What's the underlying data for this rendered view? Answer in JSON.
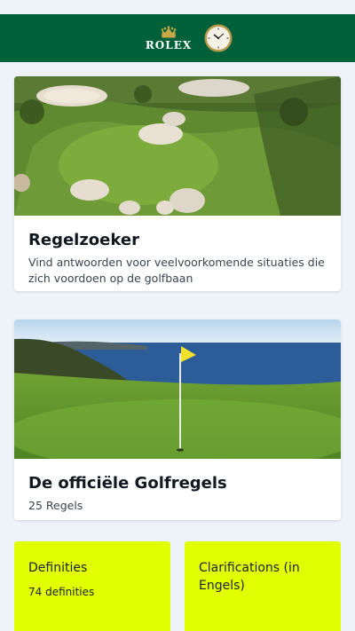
{
  "header": {
    "brand_word": "ROLEX",
    "logo_icon": "rolex-crown-icon",
    "clock_icon": "rolex-clock-icon",
    "bg_color": "#006039"
  },
  "cards": {
    "rules_finder": {
      "title": "Regelzoeker",
      "subtitle": "Vind antwoorden voor veelvoorkomende situaties die zich voordoen op de golfbaan"
    },
    "official_rules": {
      "title": "De officiële Golfregels",
      "count_label": "25 Regels"
    }
  },
  "tiles": {
    "definitions": {
      "title": "Definities",
      "count_label": "74 definities"
    },
    "clarifications": {
      "title": "Clarifications (in Engels)"
    },
    "accent_color": "#e1ff00"
  }
}
